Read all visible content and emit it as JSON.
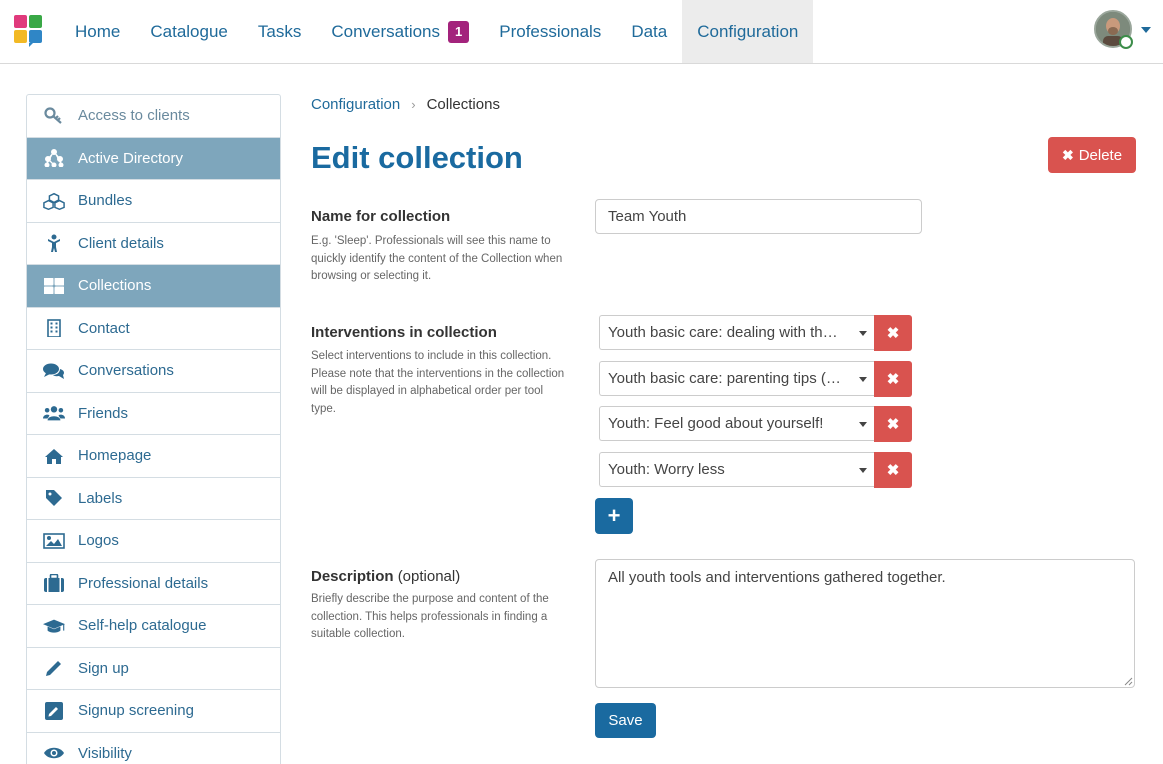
{
  "nav": {
    "items": [
      {
        "label": "Home"
      },
      {
        "label": "Catalogue"
      },
      {
        "label": "Tasks"
      },
      {
        "label": "Conversations",
        "badge": "1"
      },
      {
        "label": "Professionals"
      },
      {
        "label": "Data"
      },
      {
        "label": "Configuration",
        "active": true
      }
    ]
  },
  "sidebar": {
    "items": [
      {
        "label": "Access to clients",
        "icon": "key-icon"
      },
      {
        "label": "Active Directory",
        "icon": "sitemap-icon",
        "active": true
      },
      {
        "label": "Bundles",
        "icon": "cubes-icon"
      },
      {
        "label": "Client details",
        "icon": "child-icon"
      },
      {
        "label": "Collections",
        "icon": "th-large-icon",
        "active": true
      },
      {
        "label": "Contact",
        "icon": "building-icon"
      },
      {
        "label": "Conversations",
        "icon": "comments-icon"
      },
      {
        "label": "Friends",
        "icon": "users-icon"
      },
      {
        "label": "Homepage",
        "icon": "home-icon"
      },
      {
        "label": "Labels",
        "icon": "tag-icon"
      },
      {
        "label": "Logos",
        "icon": "image-icon"
      },
      {
        "label": "Professional details",
        "icon": "briefcase-icon"
      },
      {
        "label": "Self-help catalogue",
        "icon": "graduation-cap-icon"
      },
      {
        "label": "Sign up",
        "icon": "pencil-icon"
      },
      {
        "label": "Signup screening",
        "icon": "edit-icon"
      },
      {
        "label": "Visibility",
        "icon": "eye-icon"
      }
    ]
  },
  "breadcrumb": {
    "parent": "Configuration",
    "separator": "›",
    "current": "Collections"
  },
  "page": {
    "title": "Edit collection",
    "delete_label": "Delete"
  },
  "name_field": {
    "label": "Name for collection",
    "help": "E.g. 'Sleep'. Professionals will see this name to quickly identify the content of the Collection when browsing or selecting it.",
    "value": "Team Youth"
  },
  "interventions": {
    "label": "Interventions in collection",
    "help": "Select interventions to include in this collection. Please note that the interventions in the collection will be displayed in alphabetical order per tool type.",
    "selected": [
      "Youth basic care: dealing with th…",
      "Youth basic care: parenting tips (…",
      "Youth: Feel good about yourself!",
      "Youth: Worry less"
    ],
    "add_label": "+"
  },
  "description": {
    "label": "Description",
    "optional": "(optional)",
    "help": "Briefly describe the purpose and content of the collection. This helps professionals in finding a suitable collection.",
    "value": "All youth tools and interventions gathered together."
  },
  "save_label": "Save",
  "colors": {
    "primary": "#1a6aa0",
    "danger": "#d9534f",
    "badge": "#a3237c",
    "sidebar_active": "#7ea6bc"
  }
}
